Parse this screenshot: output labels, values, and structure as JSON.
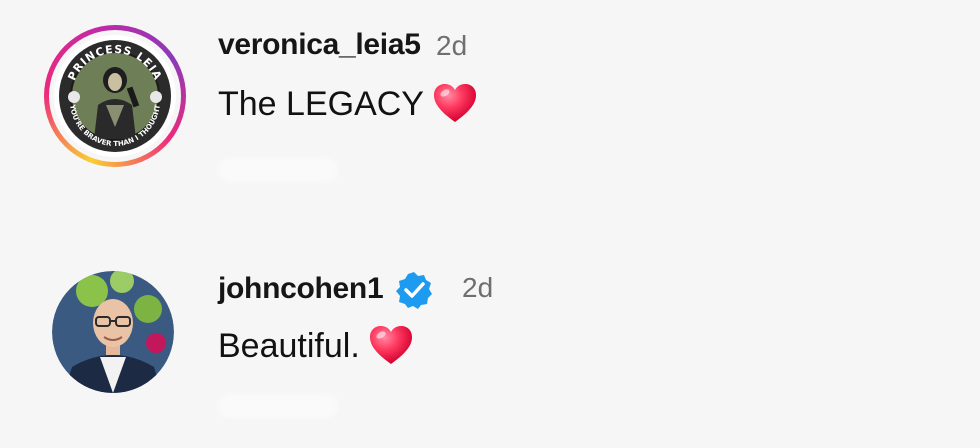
{
  "comments": [
    {
      "username": "veronica_leia5",
      "time": "2d",
      "text": "The LEGACY",
      "reaction": "heart-icon",
      "has_story_ring": true,
      "verified": false
    },
    {
      "username": "johncohen1",
      "time": "2d",
      "text": "Beautiful.",
      "reaction": "heart-icon",
      "has_story_ring": false,
      "verified": true
    }
  ],
  "colors": {
    "background": "#f6f6f6",
    "verified_blue": "#1d9bf0",
    "heart_red": "#ff2d55",
    "timestamp_gray": "#6f6f6f"
  }
}
